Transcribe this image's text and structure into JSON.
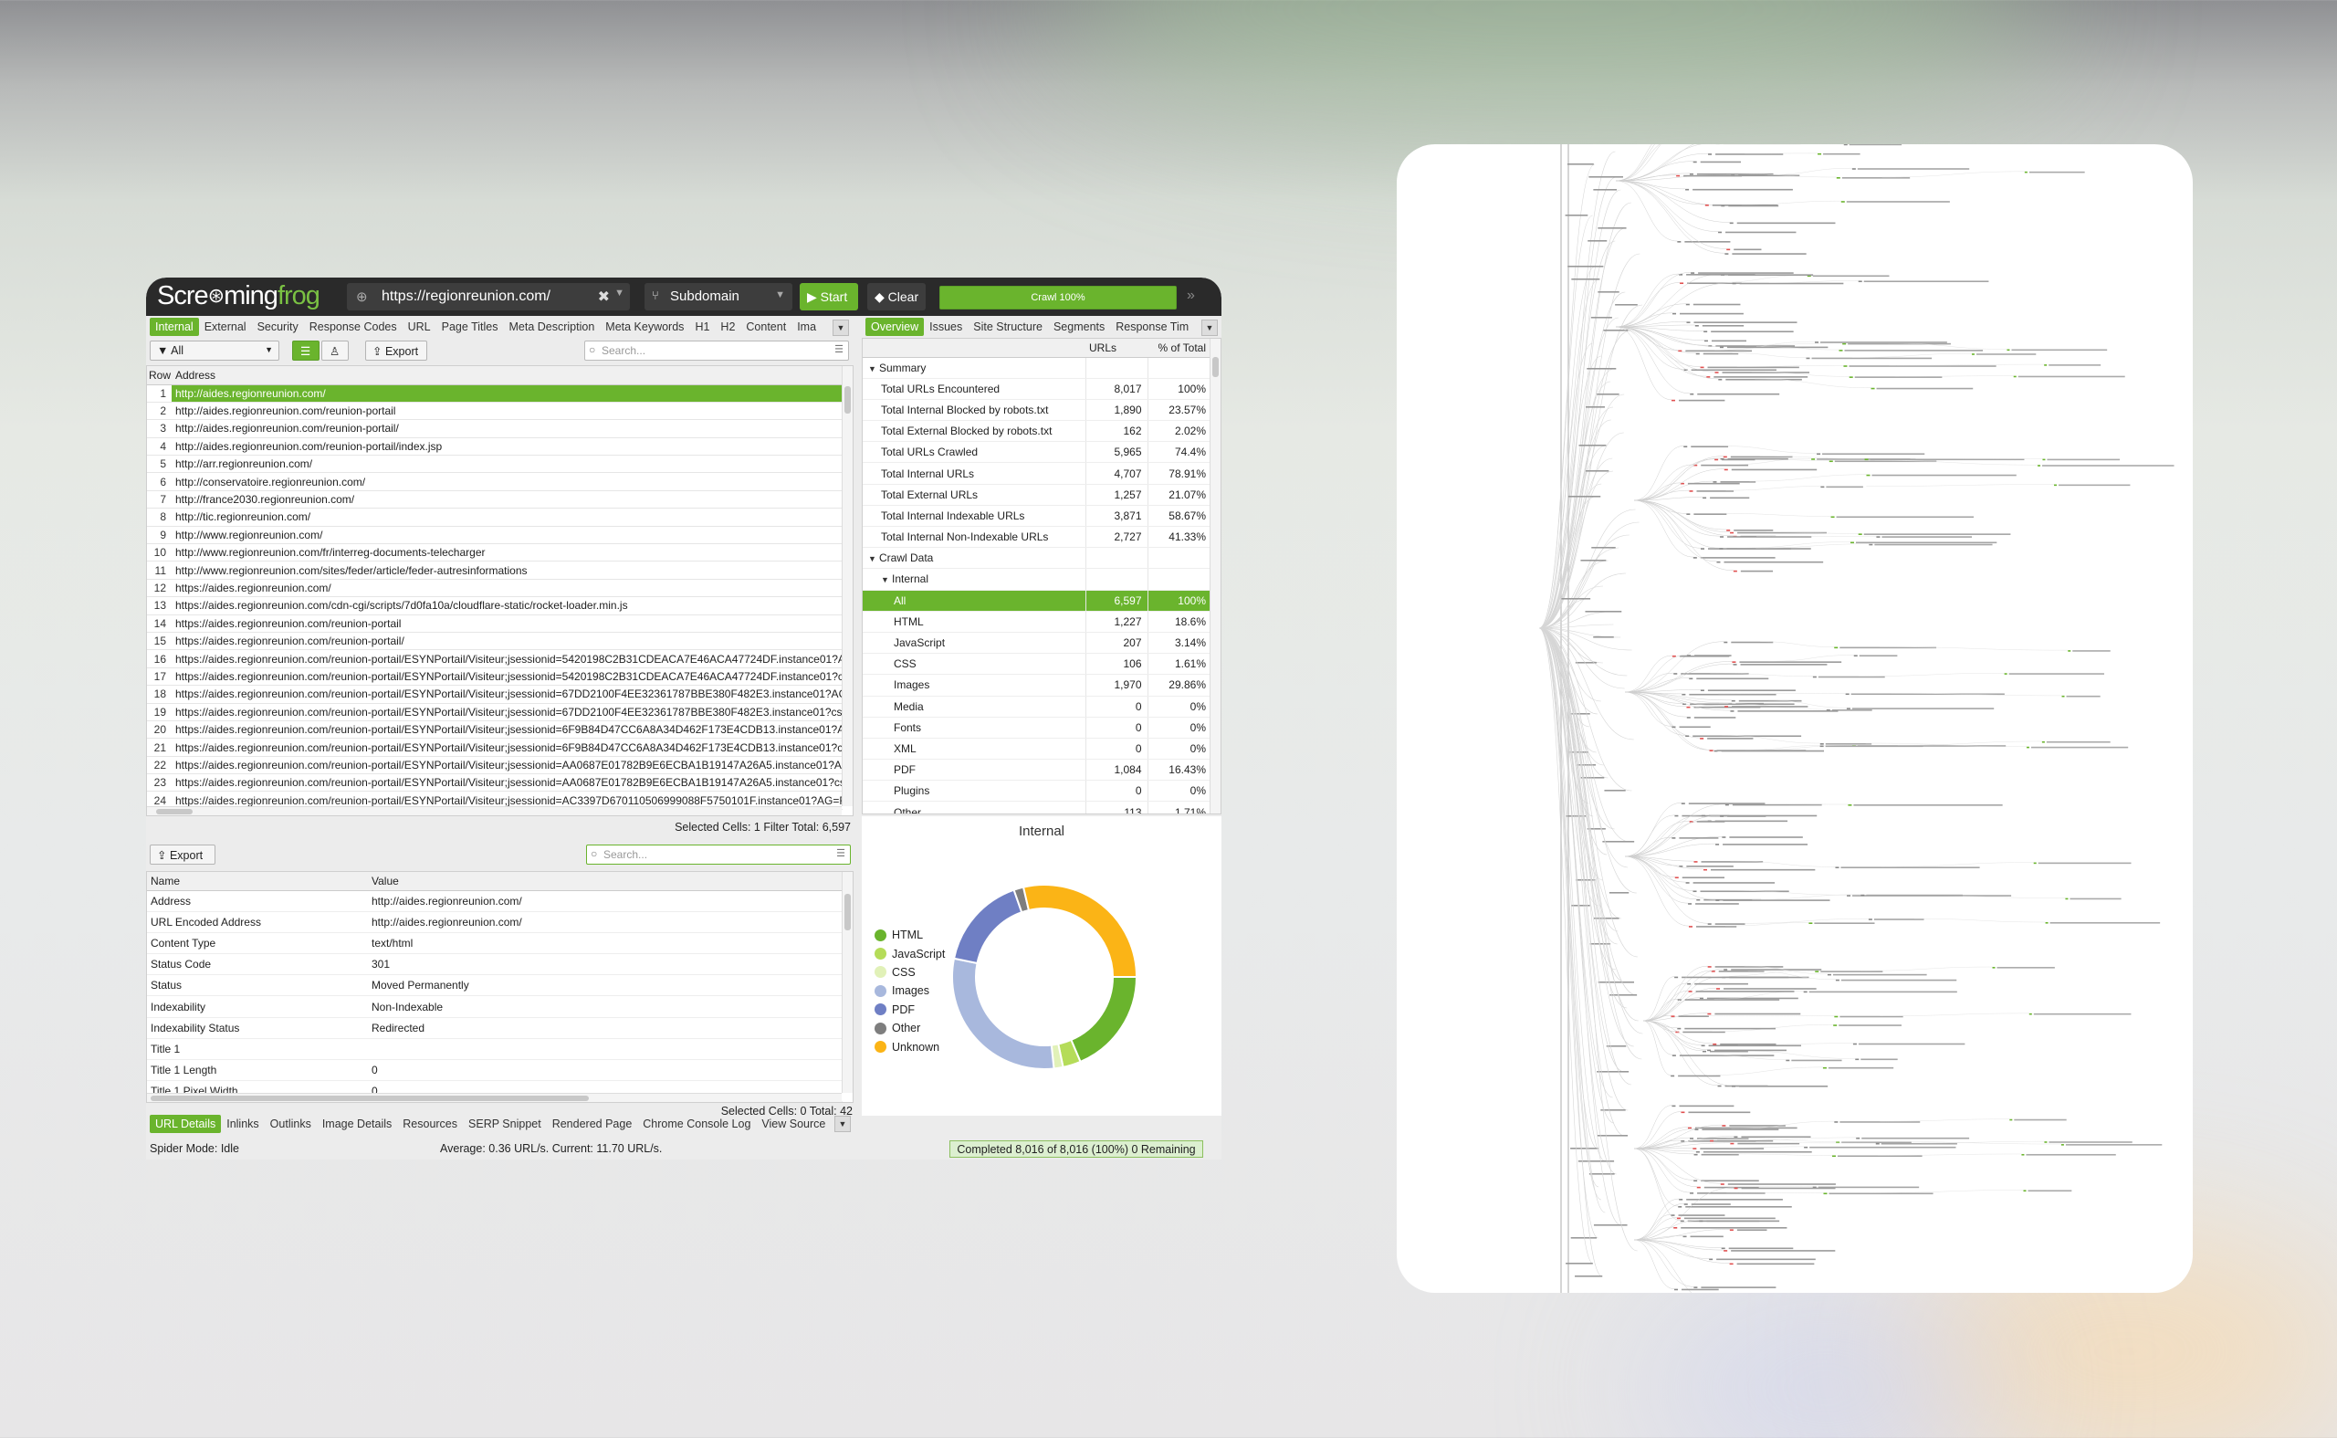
{
  "app": {
    "logo_a": "Scre",
    "logo_b": "ming",
    "logo_c": "frog",
    "url": "https://regionreunion.com/",
    "mode": "Subdomain",
    "start_label": "Start",
    "clear_label": "Clear",
    "crawl_progress_label": "Crawl 100%",
    "crawl_progress_fraction": 1.0
  },
  "left_tabs": [
    "Internal",
    "External",
    "Security",
    "Response Codes",
    "URL",
    "Page Titles",
    "Meta Description",
    "Meta Keywords",
    "H1",
    "H2",
    "Content",
    "Ima"
  ],
  "filter": {
    "selected": "All"
  },
  "export_label": "Export",
  "search_placeholder": "Search...",
  "url_table": {
    "headers": [
      "Row",
      "Address"
    ],
    "rows": [
      {
        "row": "1",
        "address": "http://aides.regionreunion.com/"
      },
      {
        "row": "2",
        "address": "http://aides.regionreunion.com/reunion-portail"
      },
      {
        "row": "3",
        "address": "http://aides.regionreunion.com/reunion-portail/"
      },
      {
        "row": "4",
        "address": "http://aides.regionreunion.com/reunion-portail/index.jsp"
      },
      {
        "row": "5",
        "address": "http://arr.regionreunion.com/"
      },
      {
        "row": "6",
        "address": "http://conservatoire.regionreunion.com/"
      },
      {
        "row": "7",
        "address": "http://france2030.regionreunion.com/"
      },
      {
        "row": "8",
        "address": "http://tic.regionreunion.com/"
      },
      {
        "row": "9",
        "address": "http://www.regionreunion.com/"
      },
      {
        "row": "10",
        "address": "http://www.regionreunion.com/fr/interreg-documents-telecharger"
      },
      {
        "row": "11",
        "address": "http://www.regionreunion.com/sites/feder/article/feder-autresinformations"
      },
      {
        "row": "12",
        "address": "https://aides.regionreunion.com/"
      },
      {
        "row": "13",
        "address": "https://aides.regionreunion.com/cdn-cgi/scripts/7d0fa10a/cloudflare-static/rocket-loader.min.js"
      },
      {
        "row": "14",
        "address": "https://aides.regionreunion.com/reunion-portail"
      },
      {
        "row": "15",
        "address": "https://aides.regionreunion.com/reunion-portail/"
      },
      {
        "row": "16",
        "address": "https://aides.regionreunion.com/reunion-portail/ESYNPortail/Visiteur;jsessionid=5420198C2B31CDEACA7E46ACA47724DF.instance01?AG="
      },
      {
        "row": "17",
        "address": "https://aides.regionreunion.com/reunion-portail/ESYNPortail/Visiteur;jsessionid=5420198C2B31CDEACA7E46ACA47724DF.instance01?csrft"
      },
      {
        "row": "18",
        "address": "https://aides.regionreunion.com/reunion-portail/ESYNPortail/Visiteur;jsessionid=67DD2100F4EE32361787BBE380F482E3.instance01?AG=R"
      },
      {
        "row": "19",
        "address": "https://aides.regionreunion.com/reunion-portail/ESYNPortail/Visiteur;jsessionid=67DD2100F4EE32361787BBE380F482E3.instance01?csrft="
      },
      {
        "row": "20",
        "address": "https://aides.regionreunion.com/reunion-portail/ESYNPortail/Visiteur;jsessionid=6F9B84D47CC6A8A34D462F173E4CDB13.instance01?AG=I"
      },
      {
        "row": "21",
        "address": "https://aides.regionreunion.com/reunion-portail/ESYNPortail/Visiteur;jsessionid=6F9B84D47CC6A8A34D462F173E4CDB13.instance01?csrft"
      },
      {
        "row": "22",
        "address": "https://aides.regionreunion.com/reunion-portail/ESYNPortail/Visiteur;jsessionid=AA0687E01782B9E6ECBA1B19147A26A5.instance01?AG=F"
      },
      {
        "row": "23",
        "address": "https://aides.regionreunion.com/reunion-portail/ESYNPortail/Visiteur;jsessionid=AA0687E01782B9E6ECBA1B19147A26A5.instance01?csrft"
      },
      {
        "row": "24",
        "address": "https://aides.regionreunion.com/reunion-portail/ESYNPortail/Visiteur;jsessionid=AC3397D670110506999088F5750101F.instance01?AG=R"
      }
    ],
    "status": "Selected Cells:  1  Filter Total:  6,597"
  },
  "right_tabs": [
    "Overview",
    "Issues",
    "Site Structure",
    "Segments",
    "Response Tim"
  ],
  "overview": {
    "headers": [
      "URLs",
      "% of Total"
    ],
    "rows": [
      {
        "type": "group",
        "label": "Summary",
        "caret": "▼",
        "indent": 0
      },
      {
        "type": "row",
        "label": "Total URLs Encountered",
        "urls": "8,017",
        "pct": "100%",
        "indent": 1
      },
      {
        "type": "row",
        "label": "Total Internal Blocked by robots.txt",
        "urls": "1,890",
        "pct": "23.57%",
        "indent": 1
      },
      {
        "type": "row",
        "label": "Total External Blocked by robots.txt",
        "urls": "162",
        "pct": "2.02%",
        "indent": 1
      },
      {
        "type": "row",
        "label": "Total URLs Crawled",
        "urls": "5,965",
        "pct": "74.4%",
        "indent": 1
      },
      {
        "type": "row",
        "label": "Total Internal URLs",
        "urls": "4,707",
        "pct": "78.91%",
        "indent": 1
      },
      {
        "type": "row",
        "label": "Total External URLs",
        "urls": "1,257",
        "pct": "21.07%",
        "indent": 1
      },
      {
        "type": "row",
        "label": "Total Internal Indexable URLs",
        "urls": "3,871",
        "pct": "58.67%",
        "indent": 1
      },
      {
        "type": "row",
        "label": "Total Internal Non-Indexable URLs",
        "urls": "2,727",
        "pct": "41.33%",
        "indent": 1
      },
      {
        "type": "group",
        "label": "Crawl Data",
        "caret": "▼",
        "indent": 0
      },
      {
        "type": "group",
        "label": "Internal",
        "caret": "▼",
        "indent": 1
      },
      {
        "type": "sel",
        "label": "All",
        "urls": "6,597",
        "pct": "100%",
        "indent": 2
      },
      {
        "type": "row",
        "label": "HTML",
        "urls": "1,227",
        "pct": "18.6%",
        "indent": 2
      },
      {
        "type": "row",
        "label": "JavaScript",
        "urls": "207",
        "pct": "3.14%",
        "indent": 2
      },
      {
        "type": "row",
        "label": "CSS",
        "urls": "106",
        "pct": "1.61%",
        "indent": 2
      },
      {
        "type": "row",
        "label": "Images",
        "urls": "1,970",
        "pct": "29.86%",
        "indent": 2
      },
      {
        "type": "row",
        "label": "Media",
        "urls": "0",
        "pct": "0%",
        "indent": 2
      },
      {
        "type": "row",
        "label": "Fonts",
        "urls": "0",
        "pct": "0%",
        "indent": 2
      },
      {
        "type": "row",
        "label": "XML",
        "urls": "0",
        "pct": "0%",
        "indent": 2
      },
      {
        "type": "row",
        "label": "PDF",
        "urls": "1,084",
        "pct": "16.43%",
        "indent": 2
      },
      {
        "type": "row",
        "label": "Plugins",
        "urls": "0",
        "pct": "0%",
        "indent": 2
      },
      {
        "type": "row",
        "label": "Other",
        "urls": "113",
        "pct": "1.71%",
        "indent": 2
      }
    ]
  },
  "chart_data": {
    "type": "pie",
    "title": "Internal",
    "categories": [
      "HTML",
      "JavaScript",
      "CSS",
      "Images",
      "PDF",
      "Other",
      "Unknown"
    ],
    "values": [
      1227,
      207,
      106,
      1970,
      1084,
      113,
      1890
    ],
    "colors": [
      "#6ab42d",
      "#b5dc59",
      "#e1f1b8",
      "#a8b8dd",
      "#6f7fc4",
      "#7e7e7e",
      "#fbb416"
    ]
  },
  "details": {
    "headers": [
      "Name",
      "Value"
    ],
    "rows": [
      {
        "name": "Address",
        "value": "http://aides.regionreunion.com/"
      },
      {
        "name": "URL Encoded Address",
        "value": "http://aides.regionreunion.com/"
      },
      {
        "name": "Content Type",
        "value": "text/html"
      },
      {
        "name": "Status Code",
        "value": "301"
      },
      {
        "name": "Status",
        "value": "Moved Permanently"
      },
      {
        "name": "Indexability",
        "value": "Non-Indexable"
      },
      {
        "name": "Indexability Status",
        "value": "Redirected"
      },
      {
        "name": "Title 1",
        "value": ""
      },
      {
        "name": "Title 1 Length",
        "value": "0"
      },
      {
        "name": "Title 1 Pixel Width",
        "value": "0"
      }
    ],
    "status": "Selected Cells:  0  Total:  42"
  },
  "bottom_tabs": [
    "URL Details",
    "Inlinks",
    "Outlinks",
    "Image Details",
    "Resources",
    "SERP Snippet",
    "Rendered Page",
    "Chrome Console Log",
    "View Source"
  ],
  "statusbar": {
    "mode": "Spider Mode: Idle",
    "speed": "Average: 0.36 URL/s. Current: 11.70 URL/s.",
    "completed": "Completed 8,016 of 8,016 (100%) 0 Remaining"
  },
  "icons": {
    "globe": "globe-icon",
    "tree": "tree-icon",
    "play": "play-icon",
    "eraser": "eraser-icon",
    "filter": "filter-icon",
    "list": "list-view-icon",
    "hierarchy": "tree-view-icon",
    "export": "export-icon",
    "search": "search-icon"
  }
}
